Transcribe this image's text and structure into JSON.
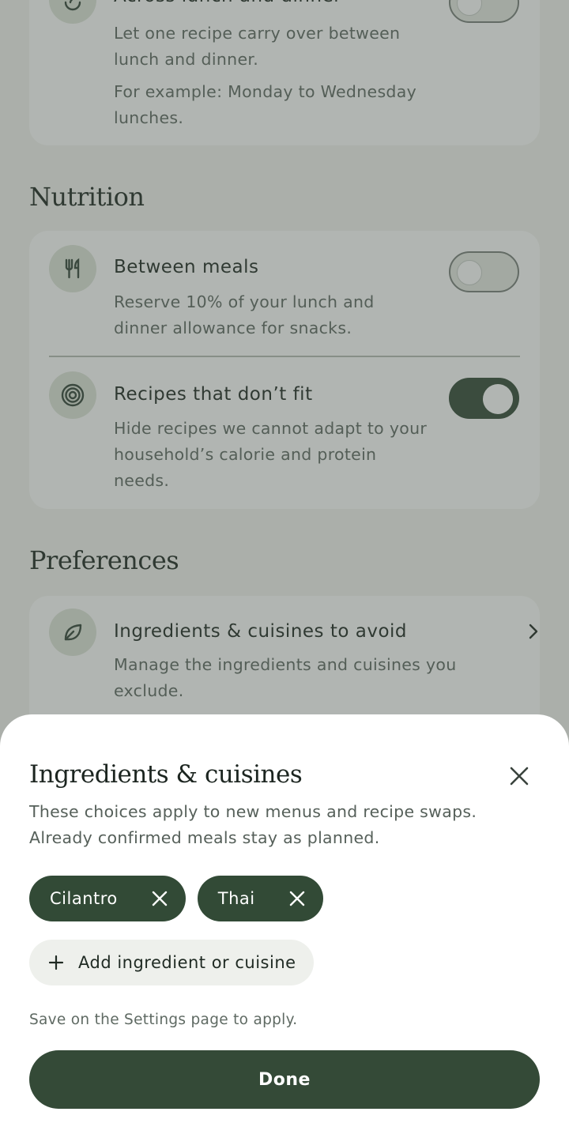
{
  "background": {
    "planning_card": {
      "title": "Across lunch and dinner",
      "desc1": "Let one recipe carry over between lunch and dinner.",
      "desc2": "For example: Monday to Wednesday lunches.",
      "toggle_on": false
    },
    "nutrition": {
      "section_title": "Nutrition",
      "items": [
        {
          "icon": "fork-knife-icon",
          "title": "Between meals",
          "desc": "Reserve 10% of your lunch and dinner allowance for snacks.",
          "toggle_on": false
        },
        {
          "icon": "target-icon",
          "title": "Recipes that don’t fit",
          "desc": "Hide recipes we cannot adapt to your household’s calorie and protein needs.",
          "toggle_on": true
        }
      ]
    },
    "preferences": {
      "section_title": "Preferences",
      "items": [
        {
          "icon": "leaf-icon",
          "title": "Ingredients & cuisines to avoid",
          "desc": "Manage the ingredients and cuisines you exclude."
        }
      ]
    }
  },
  "sheet": {
    "title": "Ingredients & cuisines",
    "description": "These choices apply to new menus and recipe swaps. Already confirmed meals stay as planned.",
    "chips": [
      {
        "label": "Cilantro"
      },
      {
        "label": "Thai"
      }
    ],
    "add_label": "Add ingredient or cuisine",
    "hint": "Save on the Settings page to apply.",
    "done_label": "Done"
  },
  "colors": {
    "primary": "#344a37",
    "icon_bg": "#dfe6da",
    "scrim": "#464e48"
  }
}
